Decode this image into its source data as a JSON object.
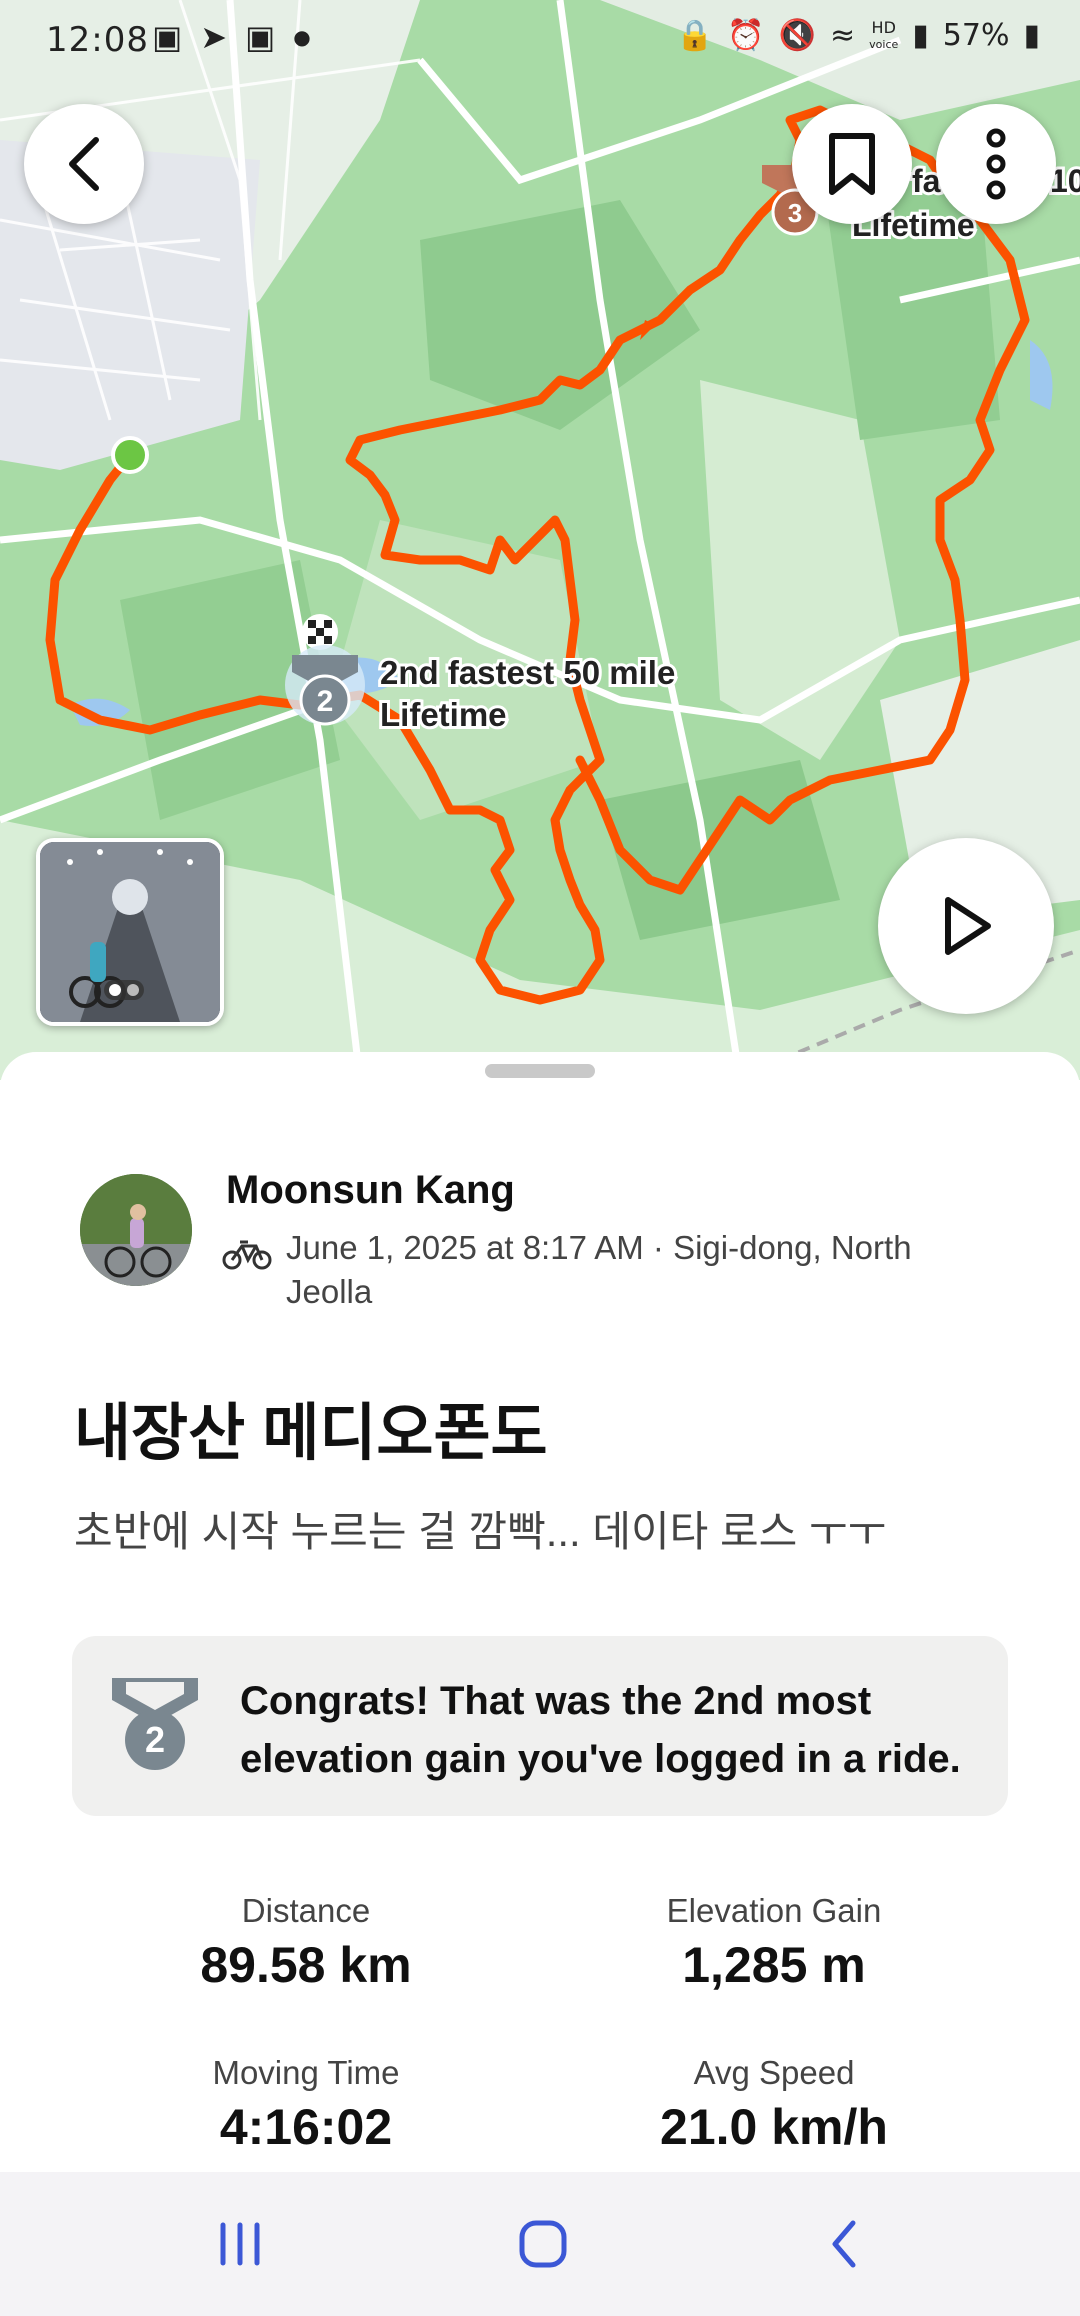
{
  "status": {
    "time": "12:08",
    "battery": "57%",
    "hd_label": "HD",
    "voice_label": "voice"
  },
  "map": {
    "best_effort_1": {
      "medal_number": "2",
      "line1": "2nd fastest 50 mile",
      "line2": "Lifetime"
    },
    "best_effort_2": {
      "medal_number": "3",
      "line1": "fa",
      "line2": "Lifetime",
      "trailing": "10"
    }
  },
  "activity": {
    "athlete_name": "Moonsun Kang",
    "meta": "June 1, 2025 at 8:17 AM · Sigi-dong, North Jeolla",
    "title": "내장산 메디오폰도",
    "description": "초반에 시작 누르는 걸 깜빡... 데이타 로스 ㅜㅜ"
  },
  "achievement": {
    "medal_number": "2",
    "text": "Congrats! That was the 2nd most elevation gain you've logged in a ride."
  },
  "stats": [
    {
      "label": "Distance",
      "value": "89.58 km"
    },
    {
      "label": "Elevation Gain",
      "value": "1,285 m"
    },
    {
      "label": "Moving Time",
      "value": "4:16:02"
    },
    {
      "label": "Avg Speed",
      "value": "21.0 km/h"
    }
  ],
  "icons": {
    "back": "back-arrow-icon",
    "bookmark": "bookmark-icon",
    "more": "more-vertical-icon",
    "play": "play-icon",
    "bike": "bike-icon",
    "medal": "medal-icon",
    "finish": "checkered-flag-icon"
  },
  "colors": {
    "route": "#fc5200",
    "map_green": "#9dd49f",
    "map_light": "#e8f3e8",
    "start_point": "#6cc644"
  }
}
